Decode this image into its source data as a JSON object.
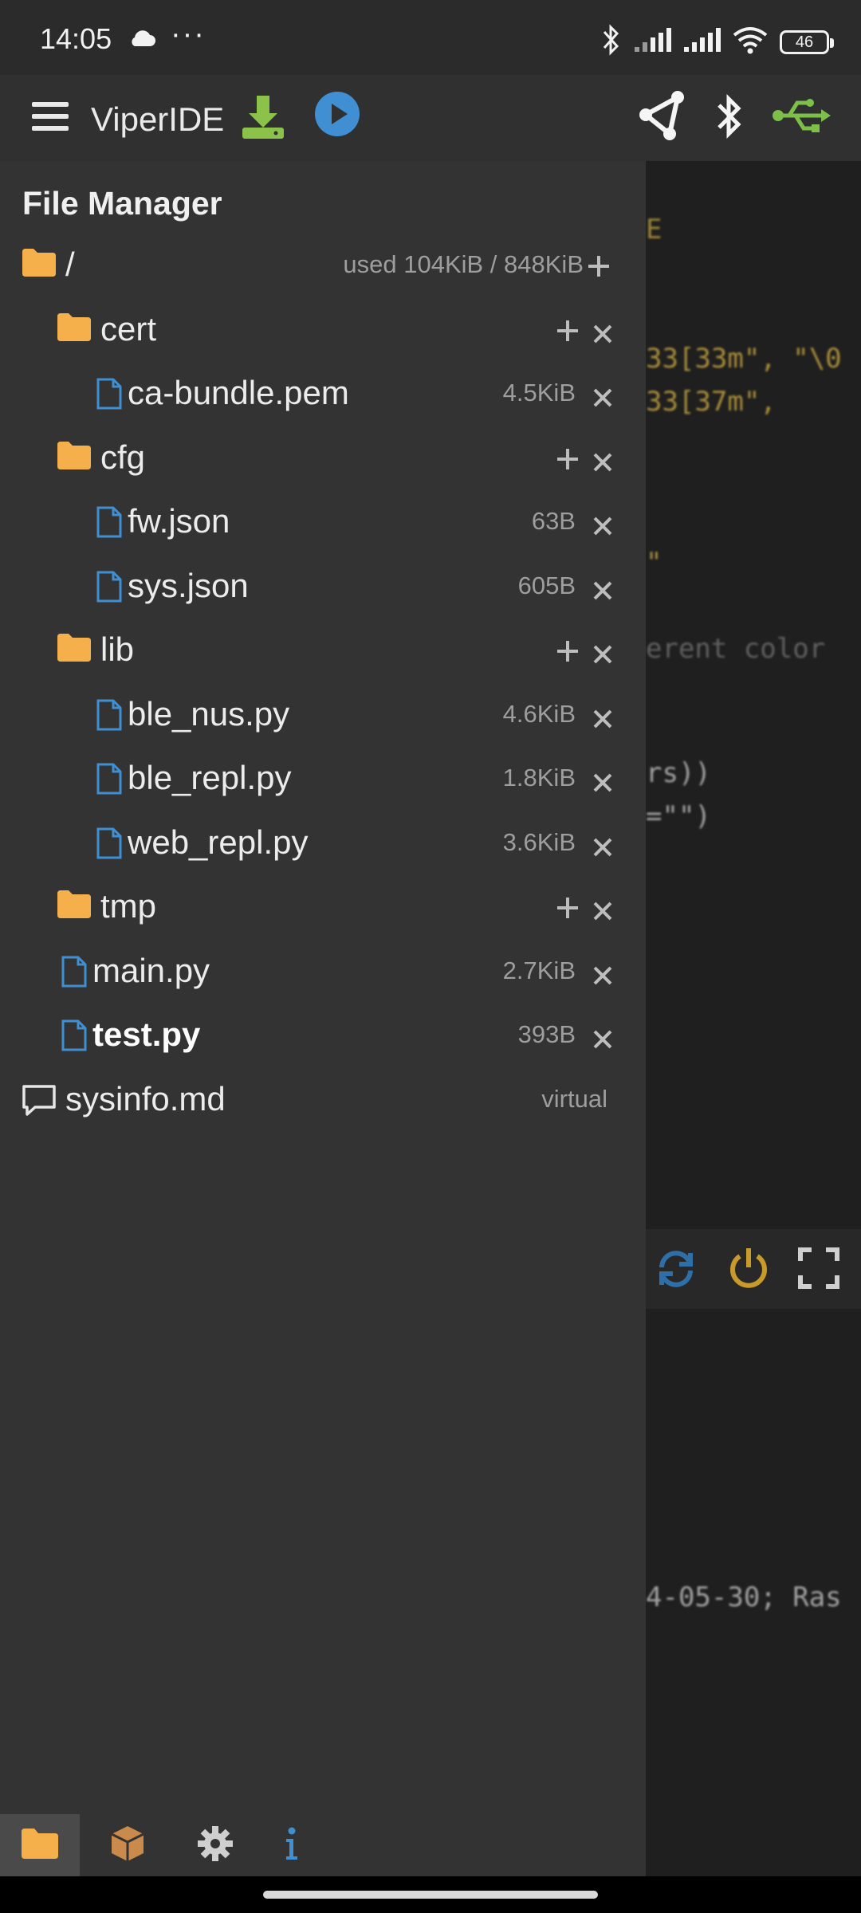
{
  "status_bar": {
    "time": "14:05",
    "dots": "···",
    "battery": "46",
    "icons": [
      "cloud-icon",
      "bluetooth-icon",
      "signal-icon",
      "signal-icon",
      "wifi-icon",
      "battery-icon"
    ]
  },
  "header": {
    "title": "ViperIDE",
    "icons": [
      "menu-icon",
      "download-icon",
      "run-icon",
      "network-icon",
      "bluetooth-icon",
      "usb-icon"
    ],
    "colors": {
      "download": "#8bc34a",
      "run": "#3f8fd2",
      "usb": "#7cc04a"
    }
  },
  "file_manager": {
    "title": "File Manager",
    "root": {
      "name": "/",
      "meta": "used 104KiB / 848KiB"
    },
    "items": [
      {
        "name": "cert",
        "type": "folder",
        "meta": ""
      },
      {
        "name": "ca-bundle.pem",
        "type": "file",
        "meta": "4.5KiB"
      },
      {
        "name": "cfg",
        "type": "folder",
        "meta": ""
      },
      {
        "name": "fw.json",
        "type": "file",
        "meta": "63B"
      },
      {
        "name": "sys.json",
        "type": "file",
        "meta": "605B"
      },
      {
        "name": "lib",
        "type": "folder",
        "meta": ""
      },
      {
        "name": "ble_nus.py",
        "type": "file",
        "meta": "4.6KiB"
      },
      {
        "name": "ble_repl.py",
        "type": "file",
        "meta": "1.8KiB"
      },
      {
        "name": "web_repl.py",
        "type": "file",
        "meta": "3.6KiB"
      },
      {
        "name": "tmp",
        "type": "folder",
        "meta": ""
      },
      {
        "name": "main.py",
        "type": "file",
        "meta": "2.7KiB"
      },
      {
        "name": "test.py",
        "type": "file",
        "meta": "393B",
        "active": true
      },
      {
        "name": "sysinfo.md",
        "type": "virtual",
        "meta": "virtual"
      }
    ],
    "colors": {
      "folder": "#f5b04c",
      "file": "#3f8fd2"
    }
  },
  "editor": {
    "code_lines": [
      "E",
      "33[33m\", \"\\0",
      "33[37m\",",
      "\"",
      "erent color",
      "rs))",
      "=\"\")",
      "4-05-30; Ras"
    ],
    "toolbar_icons": [
      "refresh-icon",
      "power-icon",
      "fullscreen-icon"
    ]
  },
  "bottom_tabs": [
    "folder-icon",
    "package-icon",
    "settings-icon",
    "info-icon"
  ]
}
